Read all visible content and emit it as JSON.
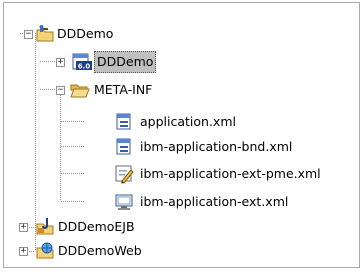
{
  "tree": {
    "root": {
      "label": "DDDemo",
      "expanded": true,
      "icon": "ear-project-icon"
    },
    "deployment_descriptor": {
      "label": "DDDemo",
      "version_badge": "6.0",
      "selected": true,
      "icon": "deployment-descriptor-icon"
    },
    "meta_inf": {
      "label": "META-INF",
      "expanded": true,
      "icon": "open-folder-icon"
    },
    "files": [
      {
        "label": "application.xml",
        "icon": "xml-descriptor-icon"
      },
      {
        "label": "ibm-application-bnd.xml",
        "icon": "xml-descriptor-icon"
      },
      {
        "label": "ibm-application-ext-pme.xml",
        "icon": "edit-xml-icon"
      },
      {
        "label": "ibm-application-ext.xml",
        "icon": "monitor-xml-icon"
      }
    ],
    "projects": [
      {
        "label": "DDDemoEJB",
        "icon": "ejb-project-icon"
      },
      {
        "label": "DDDemoWeb",
        "icon": "web-project-icon"
      }
    ],
    "expander_symbols": {
      "collapsed": "+",
      "expanded": "−"
    }
  }
}
